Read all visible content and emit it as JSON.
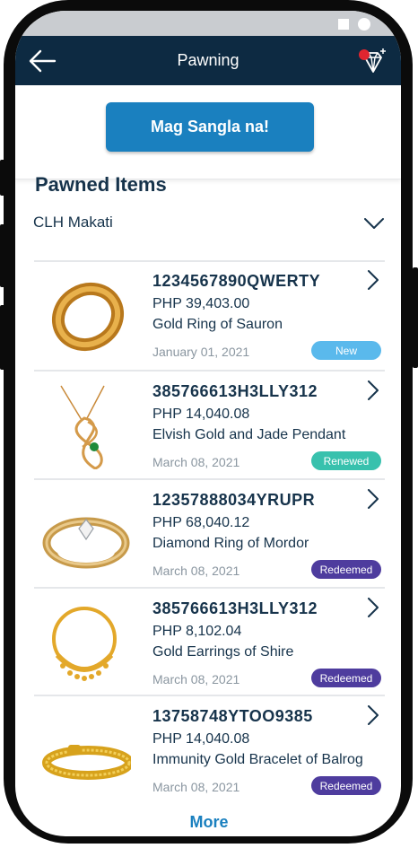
{
  "appbar": {
    "title": "Pawning"
  },
  "cta": {
    "label": "Mag Sangla na!"
  },
  "section": {
    "title": "Pawned Items"
  },
  "branch": {
    "selected": "CLH Makati"
  },
  "items": [
    {
      "code": "1234567890QWERTY",
      "price": "PHP 39,403.00",
      "name": "Gold Ring of Sauron",
      "date": "January 01, 2021",
      "status": "New",
      "status_color": "#5ab9ec",
      "image": "gold-ring-icon"
    },
    {
      "code": "385766613H3LLY312",
      "price": "PHP 14,040.08",
      "name": "Elvish Gold and Jade Pendant",
      "date": "March 08, 2021",
      "status": "Renewed",
      "status_color": "#38c1ad",
      "image": "jade-pendant-icon"
    },
    {
      "code": "12357888034YRUPR",
      "price": "PHP 68,040.12",
      "name": "Diamond Ring of Mordor",
      "date": "March 08, 2021",
      "status": "Redeemed",
      "status_color": "#4e3c9e",
      "image": "diamond-ring-icon"
    },
    {
      "code": "385766613H3LLY312",
      "price": "PHP 8,102.04",
      "name": "Gold Earrings of Shire",
      "date": "March 08, 2021",
      "status": "Redeemed",
      "status_color": "#4e3c9e",
      "image": "gold-earring-icon"
    },
    {
      "code": "13758748YTOO9385",
      "price": "PHP 14,040.08",
      "name": "Immunity Gold Bracelet of Balrog",
      "date": "March 08, 2021",
      "status": "Redeemed",
      "status_color": "#4e3c9e",
      "image": "gold-bracelet-icon"
    }
  ],
  "more": {
    "label": "More"
  },
  "colors": {
    "appbar_bg": "#0d2a42",
    "accent": "#1a80bf",
    "text": "#16334b",
    "muted": "#8a96a0"
  }
}
